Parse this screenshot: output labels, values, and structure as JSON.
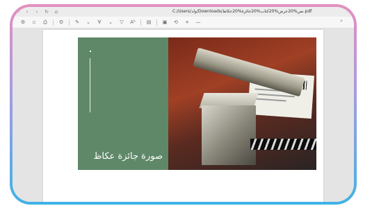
{
  "window": {
    "url": "C:/Users/ولد/Downloads/نص%20عرض%20كتاب%20جائزة%20عكاظ.pdf"
  },
  "toolbar": {
    "search_icon": "search-icon",
    "zoom_in": "+",
    "zoom_out": "—"
  },
  "slide": {
    "title": "صورة جائزة عكاظ"
  },
  "colors": {
    "frame_top": "#e48fc0",
    "frame_bottom": "#3fb2e4",
    "slide_green": "#5f8868"
  }
}
